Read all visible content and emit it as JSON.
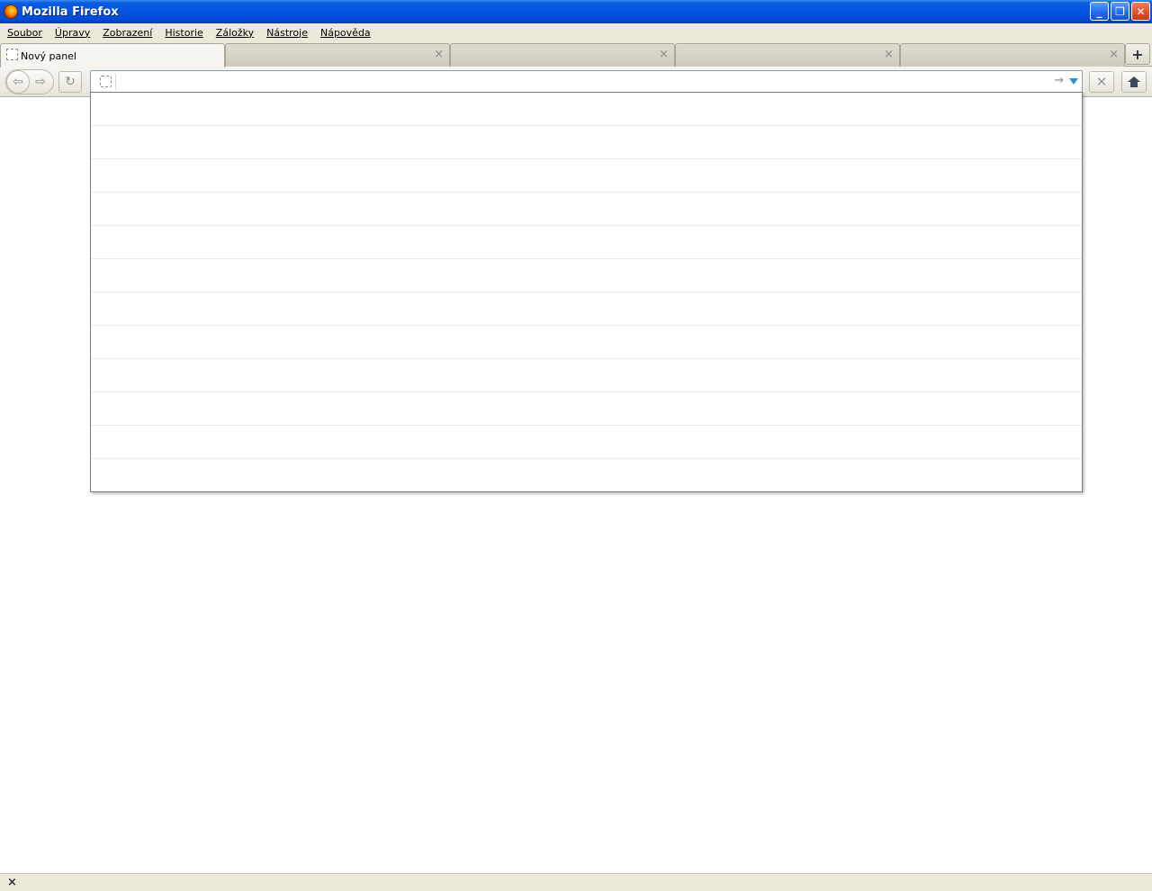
{
  "window": {
    "title": "Mozilla Firefox",
    "minimize_label": "_",
    "restore_label": "❐",
    "close_label": "✕"
  },
  "menubar": {
    "items": [
      "Soubor",
      "Úpravy",
      "Zobrazení",
      "Historie",
      "Záložky",
      "Nástroje",
      "Nápověda"
    ]
  },
  "tabs": {
    "items": [
      {
        "label": "Nový panel",
        "selected": true
      },
      {
        "label": "",
        "selected": false
      },
      {
        "label": "",
        "selected": false
      },
      {
        "label": "",
        "selected": false
      },
      {
        "label": "",
        "selected": false
      }
    ],
    "close_glyph": "×",
    "new_tab_glyph": "+"
  },
  "navbar": {
    "back_glyph": "⇦",
    "forward_glyph": "⇨",
    "reload_glyph": "↻",
    "url_value": "",
    "go_glyph": "→",
    "stop_glyph": "✕",
    "icons": {
      "back": "back-arrow-icon",
      "forward": "forward-arrow-icon",
      "reload": "reload-icon",
      "identity": "page-identity-icon",
      "go": "go-arrow-icon",
      "dropdown": "history-dropdown-icon",
      "stop": "stop-icon",
      "home": "home-icon"
    }
  },
  "autocomplete": {
    "rows": [
      "",
      "",
      "",
      "",
      "",
      "",
      "",
      "",
      "",
      "",
      "",
      ""
    ]
  },
  "statusbar": {
    "close_glyph": "×"
  },
  "colors": {
    "titlebar": "#0454e2",
    "chrome": "#ece9d8",
    "dropmarker": "#2d8fd6"
  }
}
